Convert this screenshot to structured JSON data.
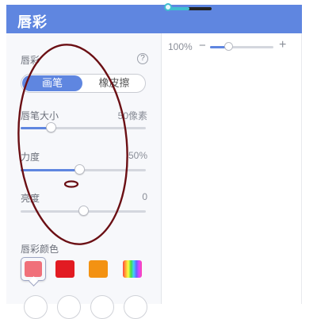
{
  "header": {
    "title": "唇彩"
  },
  "top_slider": {
    "level": 0.45,
    "accent": "#3fbfd0"
  },
  "panel": {
    "section_title": "唇彩",
    "help_icon": "question-circle-icon",
    "tool_toggle": {
      "active": "画笔",
      "inactive": "橡皮擦"
    },
    "size": {
      "label": "唇笔大小",
      "value": "50像素",
      "level": 0.25
    },
    "strength": {
      "label": "力度",
      "value": "50%",
      "level": 0.5
    },
    "brightness": {
      "label": "亮度",
      "value": "0",
      "level": 0.5
    },
    "color_section": {
      "label": "唇彩颜色"
    },
    "swatches": [
      {
        "name": "pink",
        "color": "#f0707a",
        "selected": true
      },
      {
        "name": "red",
        "color": "#e21b22",
        "selected": false
      },
      {
        "name": "orange",
        "color": "#f39212",
        "selected": false
      },
      {
        "name": "rainbow",
        "color": "rainbow",
        "selected": false
      }
    ]
  },
  "zoom": {
    "value": "100%",
    "minus": "−",
    "plus": "+",
    "level": 0.25
  },
  "colors": {
    "accent": "#5f86e0",
    "annotation": "#6b0f14"
  }
}
